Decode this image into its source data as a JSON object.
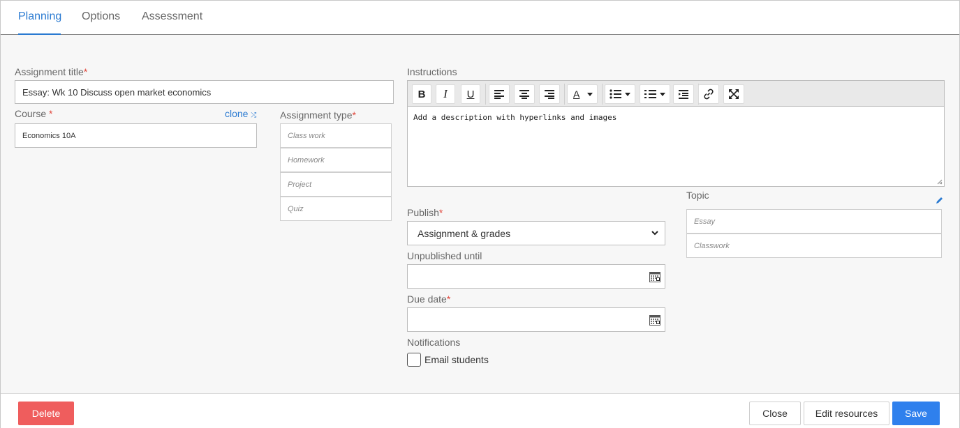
{
  "tabs": [
    {
      "label": "Planning"
    },
    {
      "label": "Options"
    },
    {
      "label": "Assessment"
    }
  ],
  "form": {
    "assignment_title": {
      "label": "Assignment title",
      "value": "Essay: Wk 10 Discuss open market economics"
    },
    "course": {
      "label": "Course",
      "value": "Economics 10A",
      "clone_label": "clone"
    },
    "assignment_type": {
      "label": "Assignment type",
      "options": [
        "Class work",
        "Homework",
        "Project",
        "Quiz"
      ]
    },
    "instructions": {
      "label": "Instructions",
      "placeholder": "Add a description with hyperlinks and images"
    },
    "publish": {
      "label": "Publish",
      "value": "Assignment & grades"
    },
    "unpublished_until": {
      "label": "Unpublished until",
      "value": ""
    },
    "due_date": {
      "label": "Due date",
      "value": ""
    },
    "notifications": {
      "label": "Notifications",
      "checkbox_label": "Email students",
      "checked": false
    },
    "topic": {
      "label": "Topic",
      "options": [
        "Essay",
        "Classwork"
      ]
    }
  },
  "toolbar": {
    "bold": "B",
    "italic": "I",
    "underline": "U",
    "font_color": "A",
    "icons": [
      "bold-icon",
      "italic-icon",
      "underline-icon",
      "align-left-icon",
      "align-center-icon",
      "align-right-icon",
      "font-color-icon",
      "bulleted-list-icon",
      "numbered-list-icon",
      "indent-icon",
      "link-icon",
      "fullscreen-icon"
    ]
  },
  "footer": {
    "delete_label": "Delete",
    "close_label": "Close",
    "edit_resources_label": "Edit resources",
    "save_label": "Save"
  },
  "colors": {
    "accent": "#2a7ad1",
    "save": "#2f80ed",
    "delete": "#ef5d5d",
    "required": "#e0453a"
  }
}
